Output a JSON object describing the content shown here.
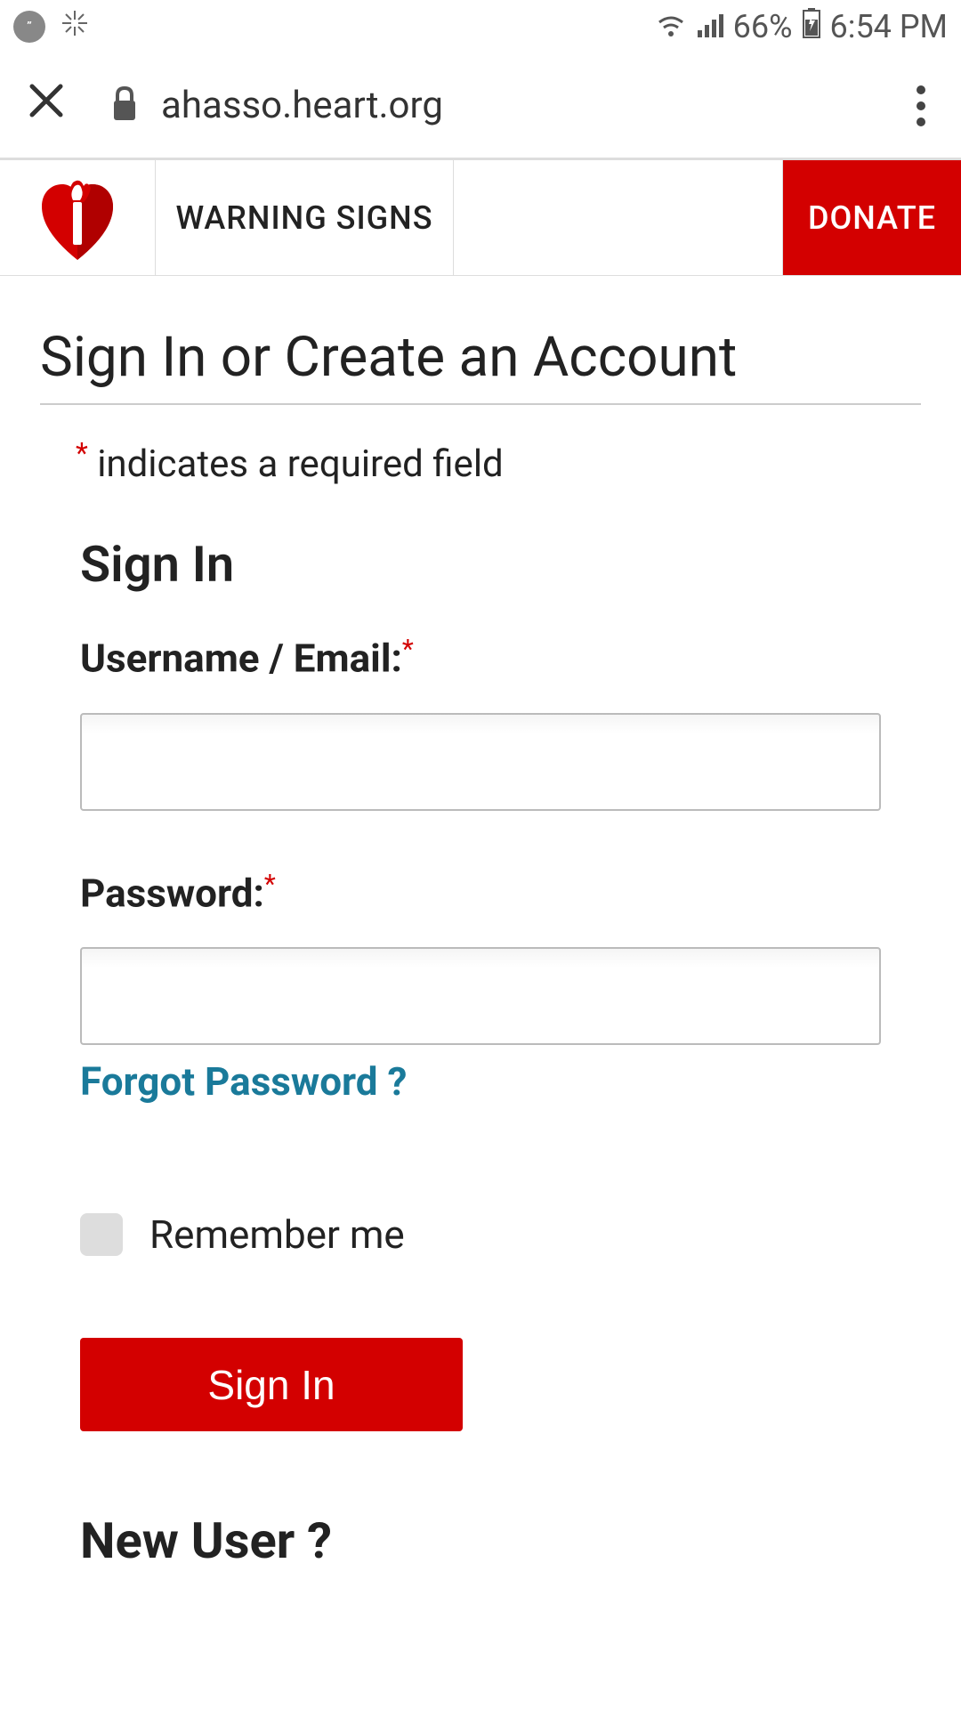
{
  "statusBar": {
    "battery": "66%",
    "time": "6:54 PM"
  },
  "browser": {
    "url": "ahasso.heart.org"
  },
  "siteHeader": {
    "warningSigns": "WARNING SIGNS",
    "donate": "DONATE"
  },
  "page": {
    "title": "Sign In or Create an Account",
    "requiredNote": "indicates a required field",
    "signInHeading": "Sign In",
    "usernameLabel": "Username / Email:",
    "usernameValue": "",
    "passwordLabel": "Password:",
    "passwordValue": "",
    "forgotPassword": "Forgot Password ?",
    "rememberMe": "Remember me",
    "signInButton": "Sign In",
    "newUserHeading": "New User ?"
  },
  "colors": {
    "primaryRed": "#d30000",
    "linkTeal": "#1a7a9a"
  }
}
